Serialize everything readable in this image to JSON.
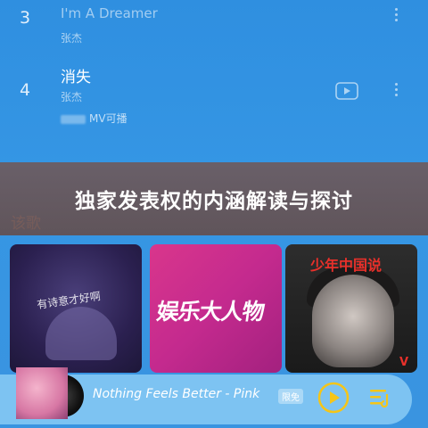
{
  "song_list": [
    {
      "rank": "3",
      "title": "I'm A Dreamer",
      "artist": "张杰"
    },
    {
      "rank": "4",
      "title": "消失",
      "artist": "张杰",
      "mv_label": "MV可播"
    }
  ],
  "banner": {
    "title": "独家发表权的内涵解读与探讨"
  },
  "section": {
    "label": "该歌"
  },
  "album_cards": [
    {
      "text": "有诗意才好啊"
    },
    {
      "text": "娱乐大人物"
    },
    {
      "text": "少年中国说",
      "mark": "V"
    }
  ],
  "player": {
    "now_playing": "Nothing Feels Better - Pink",
    "quality_badge": "限免"
  },
  "colors": {
    "accent": "#3596e4",
    "player_bar": "#7dc3f2"
  }
}
